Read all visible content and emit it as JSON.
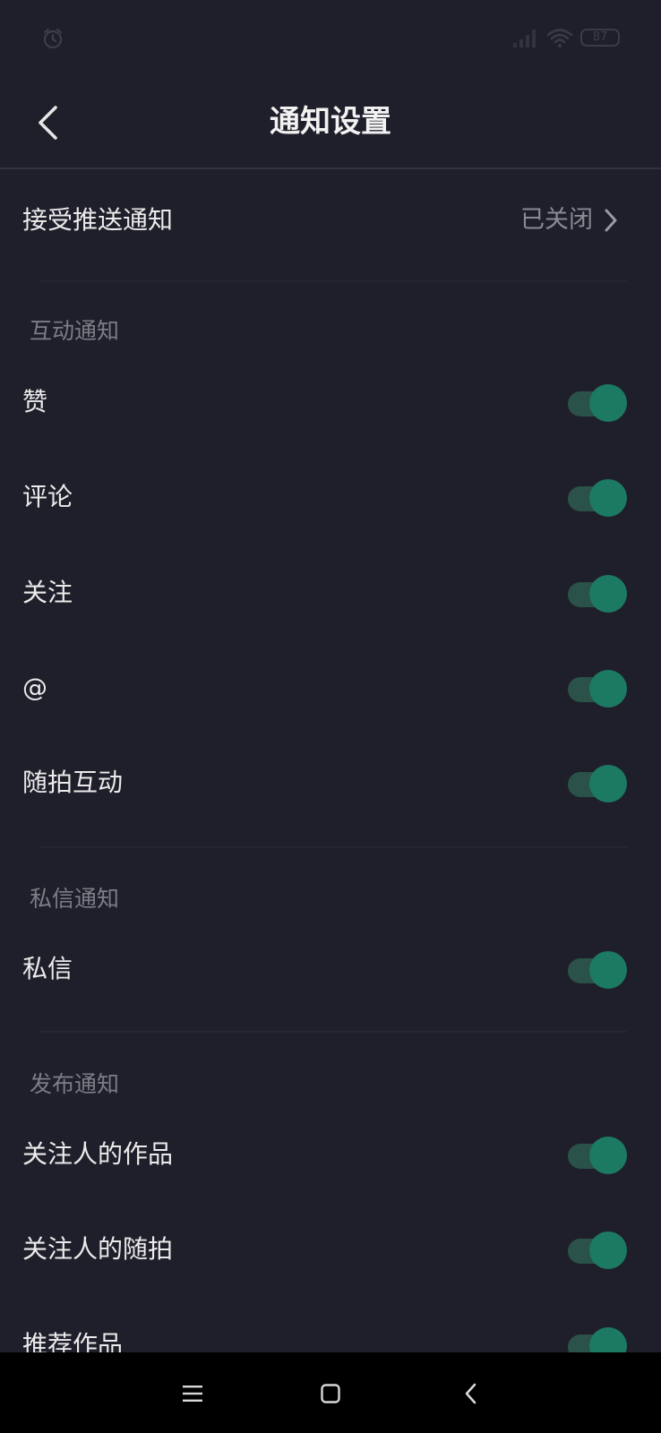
{
  "status_bar": {
    "battery_level": "87",
    "icons": [
      "alarm-icon",
      "signal-icon",
      "wifi-icon",
      "battery-icon"
    ]
  },
  "nav": {
    "title": "通知设置",
    "back_icon": "chevron-left-icon"
  },
  "push": {
    "label": "接受推送通知",
    "status": "已关闭"
  },
  "sections": {
    "interaction": {
      "header": "互动通知",
      "items": [
        {
          "label": "赞",
          "enabled": true
        },
        {
          "label": "评论",
          "enabled": true
        },
        {
          "label": "关注",
          "enabled": true
        },
        {
          "label": "@",
          "enabled": true
        },
        {
          "label": "随拍互动",
          "enabled": true
        }
      ]
    },
    "messages": {
      "header": "私信通知",
      "items": [
        {
          "label": "私信",
          "enabled": true
        }
      ]
    },
    "publish": {
      "header": "发布通知",
      "items": [
        {
          "label": "关注人的作品",
          "enabled": true
        },
        {
          "label": "关注人的随拍",
          "enabled": true
        },
        {
          "label": "推荐作品",
          "enabled": true
        }
      ]
    }
  },
  "colors": {
    "background": "#1f1f2b",
    "toggle_on_knob": "#1c7a62",
    "toggle_on_track": "#2b5248",
    "secondary_text": "#8a8a95"
  },
  "system_nav": {
    "icons": [
      "menu-icon",
      "home-icon",
      "back-icon"
    ]
  }
}
